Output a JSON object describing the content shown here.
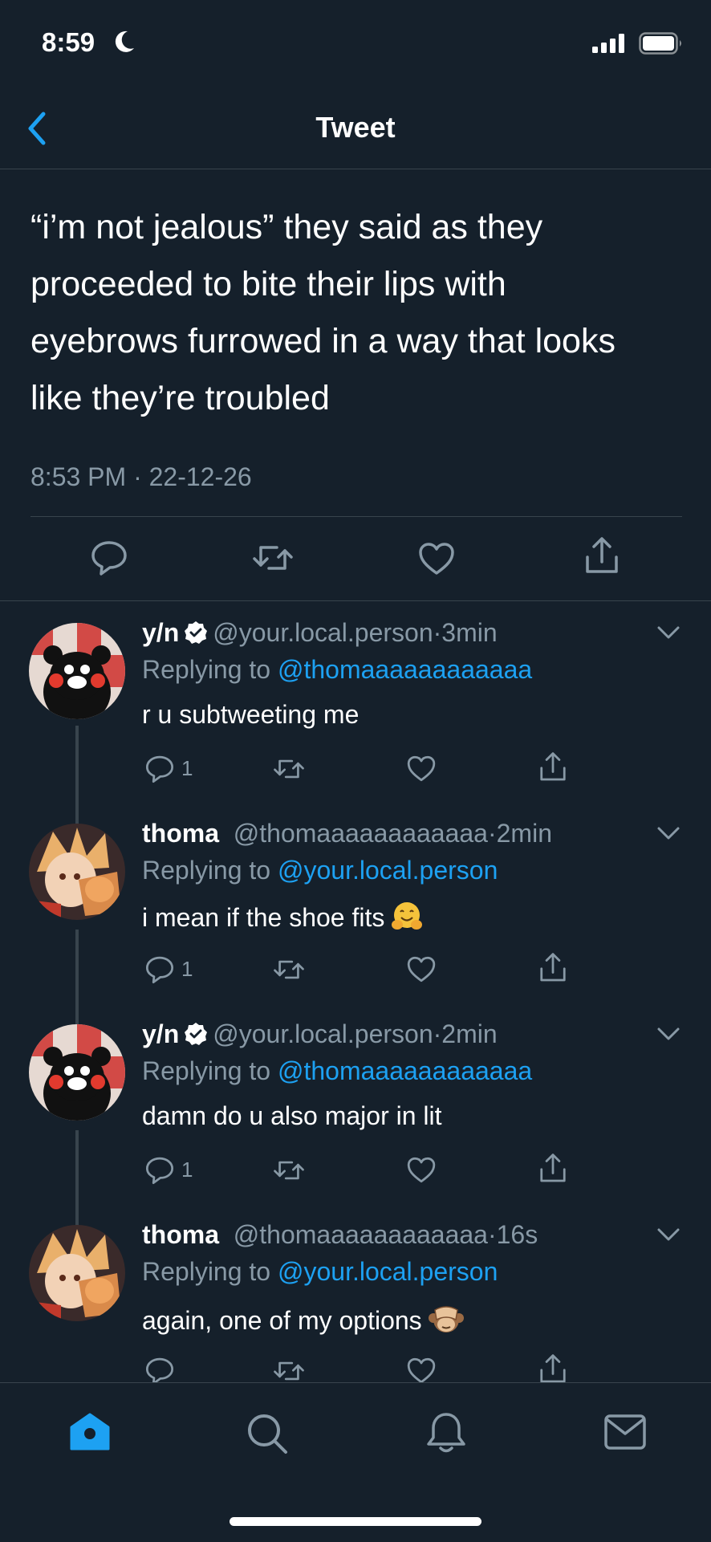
{
  "status_bar": {
    "time": "8:59"
  },
  "header": {
    "title": "Tweet"
  },
  "tweet": {
    "lines": [
      "“i’m not jealous” they said as they",
      "proceeded to bite their lips with",
      "eyebrows furrowed in a way that looks",
      "like they’re troubled"
    ],
    "timestamp": "8:53 PM · 22-12-26"
  },
  "replies": [
    {
      "name": "y/n",
      "verified": true,
      "handle": "@your.local.person",
      "dot": "·",
      "age": "3min",
      "replying_label": "Replying to",
      "replying_to": "@thomaaaaaaaaaaaa",
      "text": "r u subtweeting me",
      "emoji": "",
      "reply_count": "1"
    },
    {
      "name": "thoma",
      "verified": false,
      "handle": "@thomaaaaaaaaaaaa",
      "dot": "·",
      "age": "2min",
      "replying_label": "Replying to",
      "replying_to": "@your.local.person",
      "text": "i mean if the shoe fits",
      "emoji": "hugging-face",
      "reply_count": "1"
    },
    {
      "name": "y/n",
      "verified": true,
      "handle": "@your.local.person",
      "dot": "·",
      "age": "2min",
      "replying_label": "Replying to",
      "replying_to": "@thomaaaaaaaaaaaa",
      "text": "damn do u also major in lit",
      "emoji": "",
      "reply_count": "1"
    },
    {
      "name": "thoma",
      "verified": false,
      "handle": "@thomaaaaaaaaaaaa",
      "dot": "·",
      "age": "16s",
      "replying_label": "Replying to",
      "replying_to": "@your.local.person",
      "text": "again, one of my options",
      "emoji": "see-no-evil-monkey",
      "reply_count": ""
    }
  ],
  "colors": {
    "background": "#15202b",
    "accent": "#1da1f2",
    "muted": "#8899a6",
    "divider": "#38444d"
  },
  "tab_bar": {
    "items": [
      "home-icon",
      "search-icon",
      "notifications-icon",
      "messages-icon"
    ],
    "active": "home-icon"
  }
}
